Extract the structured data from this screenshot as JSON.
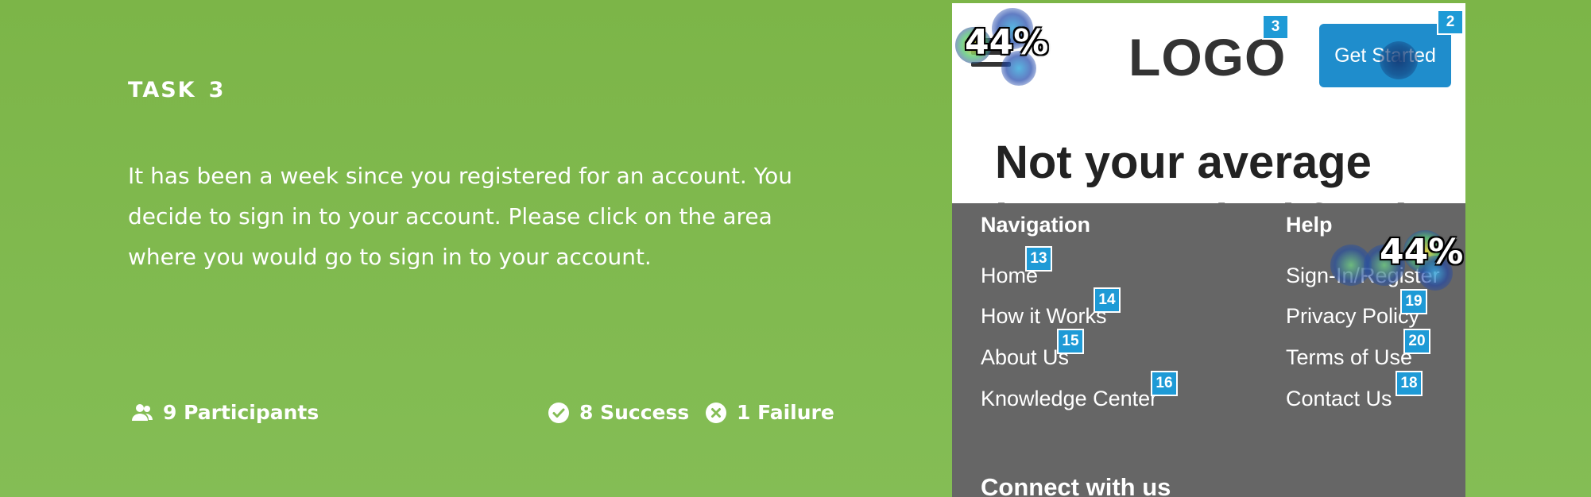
{
  "task": {
    "label": "TASK",
    "number": "3",
    "description": "It has been a week since you registered for an account. You decide to sign in to your account. Please click on the area where you would go to sign in to your account."
  },
  "stats": {
    "participants": "9 Participants",
    "success": "8 Success",
    "failure": "1 Failure"
  },
  "mock_site": {
    "logo": "LOGO",
    "get_started": "Get Started",
    "hero_line1": "Not your average",
    "hero_line2": "home-cooked food",
    "footer": {
      "navigation_title": "Navigation",
      "help_title": "Help",
      "navigation_links": [
        "Home",
        "How it Works",
        "About Us",
        "Knowledge Center"
      ],
      "help_links": [
        "Sign-In/Register",
        "Privacy Policy",
        "Terms of Use",
        "Contact Us"
      ],
      "connect_title": "Connect with us"
    }
  },
  "badges": {
    "get_started": "2",
    "logo": "3",
    "home": "13",
    "how_it_works": "14",
    "about_us": "15",
    "knowledge_center": "16",
    "contact_us": "18",
    "privacy_policy": "19",
    "terms_of_use": "20"
  },
  "heatmap": {
    "menu_click_percent": "44%",
    "signin_click_percent": "44%"
  },
  "colors": {
    "background": "#7cb548",
    "button": "#1f8dcc",
    "footer": "#666666",
    "badge": "#1e9ad6"
  }
}
